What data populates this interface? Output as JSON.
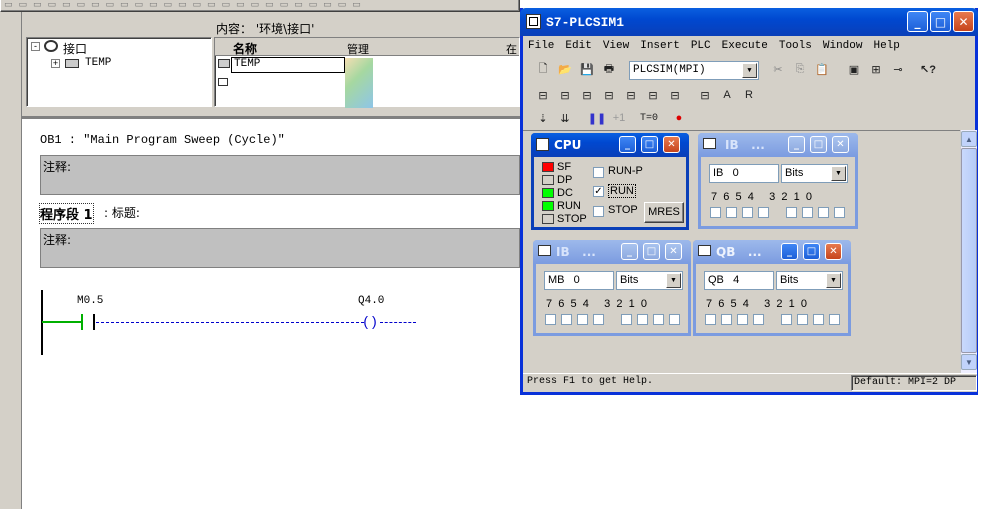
{
  "editor": {
    "content_path": "内容：  '环境\\接口'",
    "tree_root": "接口",
    "tree_child": "TEMP",
    "col_name": "名称",
    "col_manage": "管理",
    "col_extra": "在",
    "row_temp": "TEMP",
    "ob_title": "OB1 :  \"Main Program Sweep (Cycle)\"",
    "comment_label_1": "注释:",
    "network_label": "程序段 1",
    "network_title": ": 标题:",
    "comment_label_2": "注释:",
    "contact_addr": "M0.5",
    "coil_addr": "Q4.0"
  },
  "plcsim": {
    "title": "S7-PLCSIM1",
    "menu": [
      "File",
      "Edit",
      "View",
      "Insert",
      "PLC",
      "Execute",
      "Tools",
      "Window",
      "Help"
    ],
    "menu_underline": [
      "F",
      "E",
      "V",
      "I",
      "P",
      "x",
      "T",
      "W",
      "H"
    ],
    "interface_combo": "PLCSIM(MPI)",
    "status_left": "Press F1 to get Help.",
    "status_right": "Default:  MPI=2 DP",
    "t0_label": "T=0",
    "plus1_label": "+1",
    "cpu": {
      "title": "CPU",
      "leds": [
        "SF",
        "DP",
        "DC",
        "RUN",
        "STOP"
      ],
      "led_colors": [
        "#ff0000",
        "#d4d0c8",
        "#00ff00",
        "#00ff00",
        "#d4d0c8"
      ],
      "mode_runp": "RUN-P",
      "mode_run": "RUN",
      "mode_stop": "STOP",
      "mres": "MRES",
      "run_checked": true
    },
    "ib": {
      "title": "IB   ...",
      "area": "IB",
      "address": "0",
      "format": "Bits",
      "bits_left": [
        "7",
        "6",
        "5",
        "4"
      ],
      "bits_right": [
        "3",
        "2",
        "1",
        "0"
      ]
    },
    "mb": {
      "title": "IB   ...",
      "area": "MB",
      "address": "0",
      "format": "Bits",
      "bits_left": [
        "7",
        "6",
        "5",
        "4"
      ],
      "bits_right": [
        "3",
        "2",
        "1",
        "0"
      ]
    },
    "qb": {
      "title": "QB   ...",
      "area": "QB",
      "address": "4",
      "format": "Bits",
      "bits_left": [
        "7",
        "6",
        "5",
        "4"
      ],
      "bits_right": [
        "3",
        "2",
        "1",
        "0"
      ]
    }
  }
}
